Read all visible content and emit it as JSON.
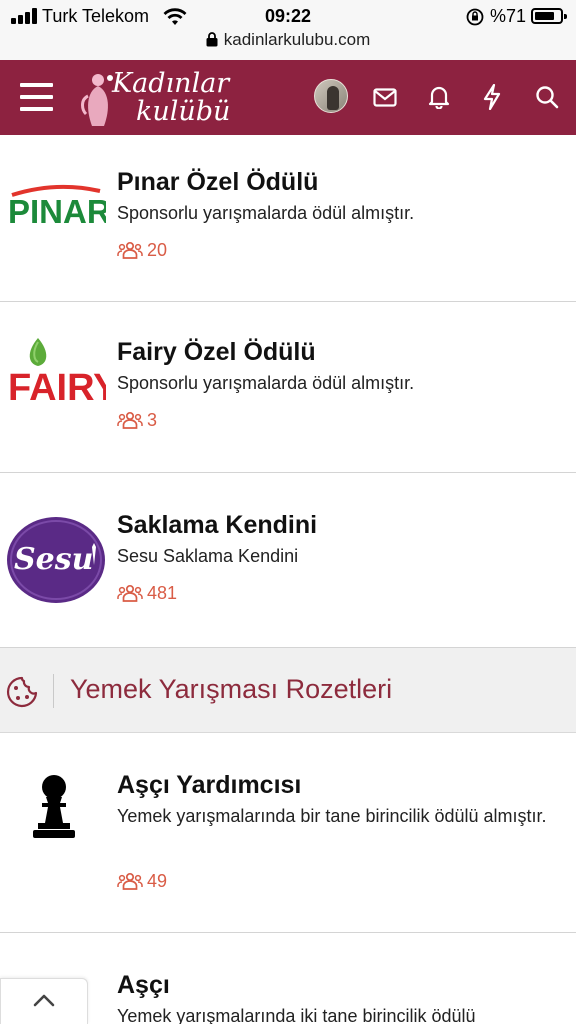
{
  "status_bar": {
    "carrier": "Turk Telekom",
    "time": "09:22",
    "battery": "%71",
    "url": "kadinlarkulubu.com"
  },
  "header": {
    "logo_line1": "Kadınlar",
    "logo_line2": "kulübü",
    "icons": [
      "menu-icon",
      "avatar",
      "mail-icon",
      "bell-icon",
      "lightning-icon",
      "search-icon"
    ],
    "color": "#8d2240"
  },
  "badges": [
    {
      "title": "Pınar Özel Ödülü",
      "description": "Sponsorlu yarışmalarda ödül almıştır.",
      "count": "20",
      "logo": "PINAR"
    },
    {
      "title": "Fairy Özel Ödülü",
      "description": "Sponsorlu yarışmalarda ödül almıştır.",
      "count": "3",
      "logo": "FAIRY"
    },
    {
      "title": "Saklama Kendini",
      "description": "Sesu Saklama Kendini",
      "count": "481",
      "logo": "Sesu"
    }
  ],
  "section": {
    "title": "Yemek Yarışması Rozetleri",
    "icon": "cookie-icon"
  },
  "food_badges": [
    {
      "title": "Aşçı Yardımcısı",
      "description": "Yemek yarışmalarında bir tane birincilik ödülü almıştır.",
      "count": "49",
      "icon": "chess-pawn-icon"
    },
    {
      "title": "Aşçı",
      "description": "Yemek yarışmalarında iki tane birincilik ödülü",
      "icon": "chess-pawn-icon"
    }
  ],
  "accent_color": "#d95c46"
}
